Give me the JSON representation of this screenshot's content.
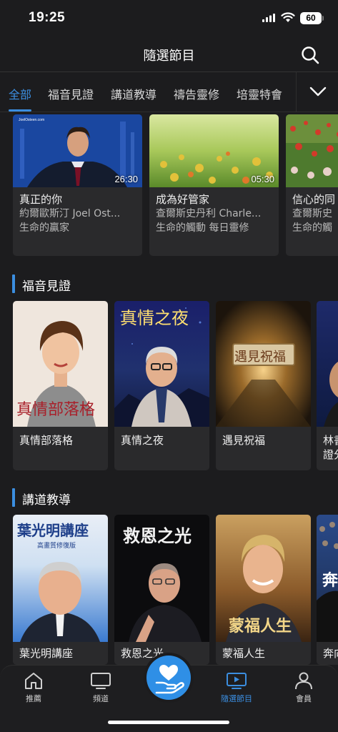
{
  "status_bar": {
    "time": "19:25",
    "battery": "60"
  },
  "header": {
    "title": "隨選節目",
    "search_icon": "search-icon"
  },
  "tabs": [
    {
      "label": "全部",
      "active": true
    },
    {
      "label": "福音見證"
    },
    {
      "label": "講道教導"
    },
    {
      "label": "禱告靈修"
    },
    {
      "label": "培靈特會"
    }
  ],
  "featured": [
    {
      "title": "真正的你",
      "speaker": "約爾歐斯汀 Joel Ost...",
      "program": "生命的贏家",
      "duration": "26:30",
      "thumb_caption": "JoelOsteen.com"
    },
    {
      "title": "成為好管家",
      "speaker": "查爾斯史丹利 Charle...",
      "program": "生命的觸動 每日靈修",
      "duration": "05:30"
    },
    {
      "title": "信心的同",
      "speaker": "查爾斯史",
      "program": "生命的觸"
    }
  ],
  "section_testimony": {
    "title": "福音見證",
    "items": [
      {
        "label": "真情部落格",
        "poster_text": "真情部落格"
      },
      {
        "label": "真情之夜",
        "poster_text": "真情之夜"
      },
      {
        "label": "遇見祝福",
        "poster_text": "遇見祝福"
      },
      {
        "label": "林書",
        "label2": "證分"
      }
    ]
  },
  "section_teaching": {
    "title": "講道教導",
    "items": [
      {
        "label": "葉光明講座",
        "poster_text": "葉光明講座",
        "poster_sub": "高畫質修復版"
      },
      {
        "label": "救恩之光",
        "poster_text": "救恩之光"
      },
      {
        "label": "蒙福人生",
        "poster_text": "蒙福人生"
      },
      {
        "label": "奔向",
        "poster_text": "奔"
      }
    ]
  },
  "bottom_nav": [
    {
      "label": "推薦",
      "icon": "home-icon"
    },
    {
      "label": "頻道",
      "icon": "tv-icon"
    },
    {
      "label": "",
      "icon": "heart-hand-icon"
    },
    {
      "label": "隨選節目",
      "icon": "play-screen-icon",
      "active": true
    },
    {
      "label": "會員",
      "icon": "person-icon"
    }
  ],
  "colors": {
    "accent": "#3b8ee0",
    "background": "#1c1c1e",
    "card": "#2a2a2c"
  }
}
